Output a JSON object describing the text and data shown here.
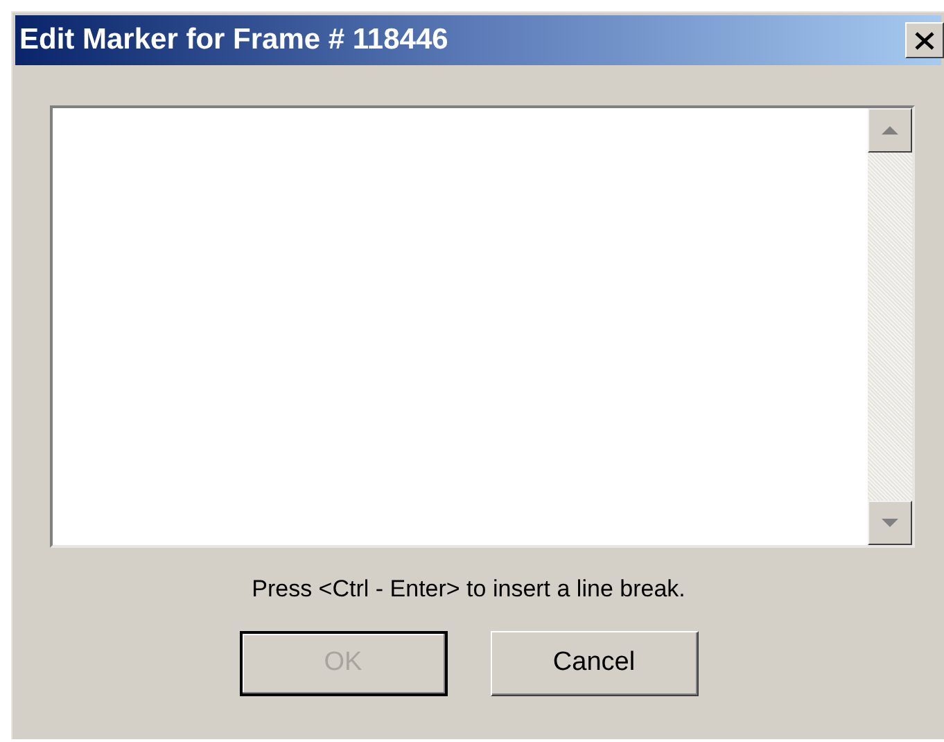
{
  "window": {
    "title": "Edit Marker for Frame # 118446"
  },
  "hint": "Press <Ctrl - Enter> to insert a line break.",
  "buttons": [
    {
      "label": "OK",
      "disabled": true
    },
    {
      "label": "Cancel",
      "disabled": false
    }
  ]
}
